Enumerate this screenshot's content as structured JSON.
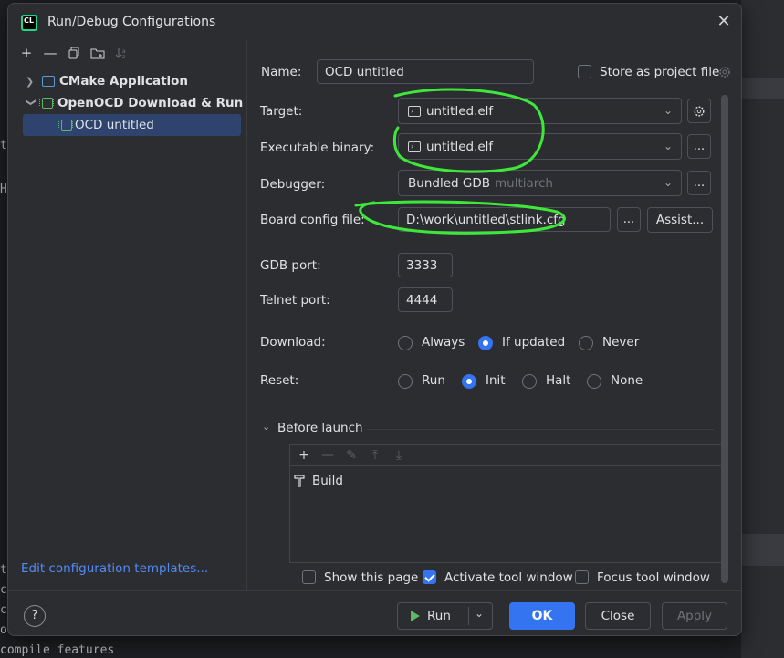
{
  "window": {
    "title": "Run/Debug Configurations",
    "logo_text": "CL"
  },
  "background": {
    "lines": [
      "t",
      "H",
      "te",
      "co",
      "co",
      "oki",
      "compile features"
    ]
  },
  "left": {
    "toolbar": [
      "add-icon",
      "remove-icon",
      "copy-icon",
      "new-folder-icon",
      "sort-icon"
    ],
    "tree": [
      {
        "label": "CMake Application",
        "expanded": false
      },
      {
        "label": "OpenOCD Download & Run",
        "expanded": true
      },
      {
        "label": "OCD untitled",
        "selected": true
      }
    ],
    "edit_templates": "Edit configuration templates..."
  },
  "form": {
    "name_label": "Name:",
    "name_value": "OCD untitled",
    "store_label": "Store as project file",
    "target_label": "Target:",
    "target_value": "untitled.elf",
    "exe_label": "Executable binary:",
    "exe_value": "untitled.elf",
    "debugger_label": "Debugger:",
    "debugger_value": "Bundled GDB",
    "debugger_hint": "multiarch",
    "board_label": "Board config file:",
    "board_value": "D:\\work\\untitled\\stlink.cfg",
    "browse": "...",
    "assist": "Assist...",
    "gdb_port_label": "GDB port:",
    "gdb_port": "3333",
    "telnet_label": "Telnet port:",
    "telnet_port": "4444",
    "download_label": "Download:",
    "download_options": [
      "Always",
      "If updated",
      "Never"
    ],
    "download_selected": "If updated",
    "reset_label": "Reset:",
    "reset_options": [
      "Run",
      "Init",
      "Halt",
      "None"
    ],
    "reset_selected": "Init",
    "before_launch": "Before launch",
    "before_items": [
      "Build"
    ],
    "show_page": "Show this page",
    "activate_tool": "Activate tool window",
    "focus_tool": "Focus tool window"
  },
  "footer": {
    "help": "?",
    "run": "Run",
    "ok": "OK",
    "close": "Close",
    "apply": "Apply"
  }
}
